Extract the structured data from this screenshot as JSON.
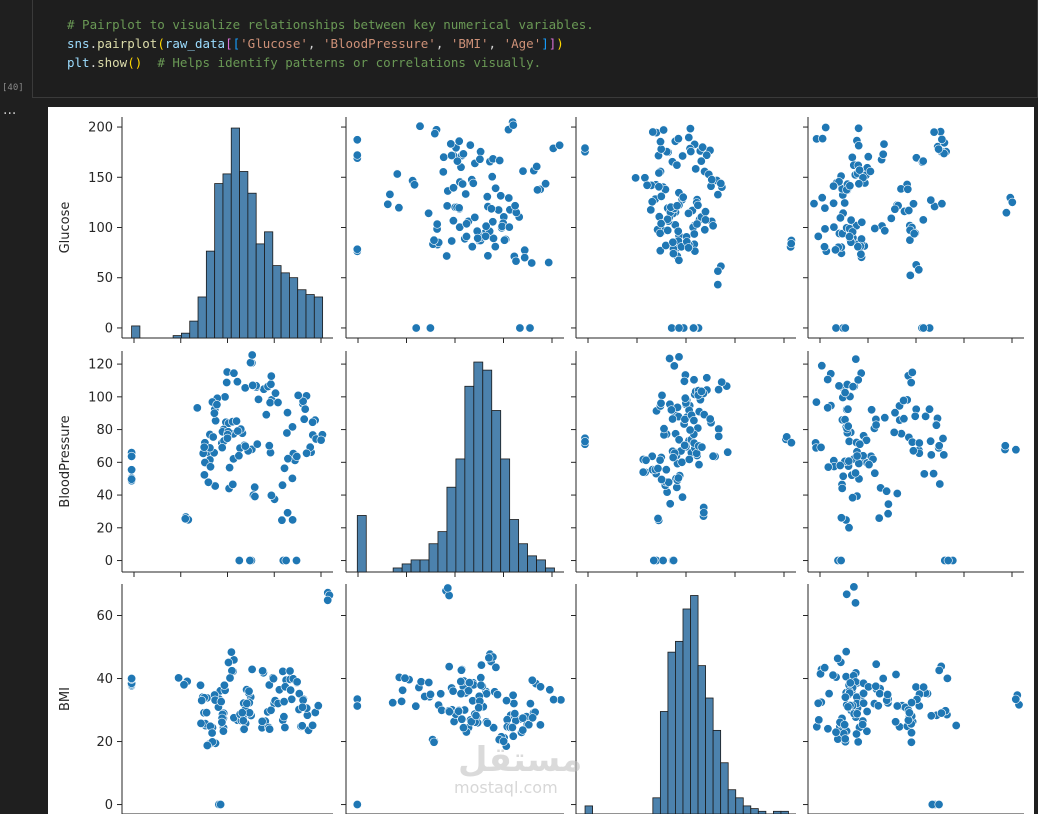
{
  "cell": {
    "execution_count": "[40]",
    "output_menu": "...",
    "code_lines": [
      {
        "tokens": [
          {
            "t": "# Pairplot to visualize relationships between key numerical variables.",
            "c": "comment"
          }
        ]
      },
      {
        "tokens": [
          {
            "t": "sns",
            "c": "var"
          },
          {
            "t": ".",
            "c": "punc"
          },
          {
            "t": "pairplot",
            "c": "func"
          },
          {
            "t": "(",
            "c": "brk1"
          },
          {
            "t": "raw_data",
            "c": "var"
          },
          {
            "t": "[",
            "c": "brk2"
          },
          {
            "t": "[",
            "c": "brk3"
          },
          {
            "t": "'Glucose'",
            "c": "str"
          },
          {
            "t": ", ",
            "c": "punc"
          },
          {
            "t": "'BloodPressure'",
            "c": "str"
          },
          {
            "t": ", ",
            "c": "punc"
          },
          {
            "t": "'BMI'",
            "c": "str"
          },
          {
            "t": ", ",
            "c": "punc"
          },
          {
            "t": "'Age'",
            "c": "str"
          },
          {
            "t": "]",
            "c": "brk3"
          },
          {
            "t": "]",
            "c": "brk2"
          },
          {
            "t": ")",
            "c": "brk1"
          }
        ]
      },
      {
        "tokens": [
          {
            "t": "plt",
            "c": "var"
          },
          {
            "t": ".",
            "c": "punc"
          },
          {
            "t": "show",
            "c": "func"
          },
          {
            "t": "()",
            "c": "brk1"
          },
          {
            "t": "  # Helps identify patterns or correlations visually.",
            "c": "comment"
          }
        ]
      }
    ]
  },
  "colors": {
    "point": "#1f77b4",
    "hist_fill": "#4c82ad",
    "hist_edge": "#1a1a1a",
    "axis": "#262626"
  },
  "watermark": {
    "text1": "مستقل",
    "text2": "mostaql.com"
  },
  "chart_data": {
    "type": "scatter",
    "kind": "pairplot",
    "variables": [
      "Glucose",
      "BloodPressure",
      "BMI",
      "Age"
    ],
    "visible_row_labels": [
      "Glucose",
      "BloodPressure",
      "BMI"
    ],
    "axes": {
      "Glucose": {
        "ylim": [
          -10,
          210
        ],
        "ticks": [
          0,
          50,
          100,
          150,
          200
        ]
      },
      "BloodPressure": {
        "ylim": [
          -7,
          128
        ],
        "ticks": [
          0,
          20,
          40,
          60,
          80,
          100,
          120
        ]
      },
      "BMI": {
        "ylim": [
          -3,
          70
        ],
        "ticks": [
          0,
          20,
          40,
          60
        ]
      }
    },
    "xlim": {
      "Glucose": [
        -10,
        210
      ],
      "BloodPressure": [
        -7,
        128
      ],
      "BMI": [
        -3,
        70
      ],
      "Age": [
        17,
        85
      ]
    },
    "histograms": {
      "Glucose": {
        "counts": [
          5,
          0,
          0,
          0,
          0,
          1,
          2,
          7,
          17,
          36,
          64,
          68,
          87,
          69,
          60,
          39,
          44,
          30,
          27,
          25,
          20,
          18,
          17
        ],
        "bin_start": 0,
        "bin_width": 8.66
      },
      "BloodPressure": {
        "counts": [
          14,
          0,
          0,
          0,
          1,
          2,
          3,
          3,
          7,
          10,
          21,
          28,
          46,
          52,
          50,
          40,
          28,
          13,
          7,
          4,
          3,
          1
        ],
        "bin_start": 0,
        "bin_width": 5.55
      },
      "BMI": {
        "counts": [
          3,
          0,
          0,
          0,
          0,
          0,
          0,
          0,
          0,
          6,
          38,
          60,
          64,
          76,
          81,
          55,
          43,
          31,
          19,
          9,
          6,
          3,
          2,
          1,
          0,
          1,
          1
        ],
        "bin_start": 0,
        "bin_width": 2.5
      }
    },
    "scatter": {
      "Glucose": [
        [
          0,
          0.06
        ],
        [
          99,
          0.3
        ],
        [
          79,
          0.24
        ],
        [
          92,
          0.08
        ],
        [
          137,
          0.38
        ],
        [
          115,
          0.6
        ],
        [
          126,
          0.18
        ],
        [
          125,
          0.28
        ],
        [
          97,
          0.44
        ],
        [
          170,
          0.51
        ],
        [
          145,
          0.15
        ],
        [
          87,
          0.71
        ],
        [
          181,
          0.36
        ],
        [
          89,
          0.4
        ],
        [
          138,
          0.2
        ],
        [
          75,
          0.69
        ],
        [
          160,
          0.25
        ],
        [
          148,
          0.55
        ],
        [
          104,
          0.6
        ],
        [
          194,
          0.45
        ],
        [
          166,
          0.28
        ],
        [
          118,
          0.5
        ],
        [
          107,
          0.17
        ],
        [
          78,
          0.2
        ],
        [
          183,
          0.37
        ],
        [
          112,
          0.64
        ],
        [
          86,
          0.52
        ],
        [
          169,
          0.43
        ],
        [
          142,
          0.27
        ],
        [
          84,
          0.13
        ],
        [
          123,
          0.82
        ],
        [
          152,
          0.35
        ],
        [
          0,
          0.36
        ],
        [
          197,
          0.28
        ],
        [
          120,
          0.19
        ],
        [
          95,
          0.46
        ],
        [
          57,
          0.36
        ],
        [
          163,
          0.3
        ],
        [
          102,
          0.47
        ],
        [
          179,
          0.55
        ]
      ],
      "BloodPressure": [
        [
          72,
          0.5
        ],
        [
          66,
          0.35
        ],
        [
          64,
          0.2
        ],
        [
          40,
          0.5
        ],
        [
          74,
          0.6
        ],
        [
          50,
          0.6
        ],
        [
          0,
          0.18
        ],
        [
          70,
          0.28
        ],
        [
          96,
          0.4
        ],
        [
          92,
          0.3
        ],
        [
          80,
          0.2
        ],
        [
          60,
          0.44
        ],
        [
          84,
          0.71
        ],
        [
          30,
          0.5
        ],
        [
          88,
          0.25
        ],
        [
          110,
          0.55
        ],
        [
          122,
          0.38
        ],
        [
          68,
          0.6
        ],
        [
          78,
          0.3
        ],
        [
          82,
          0.45
        ],
        [
          76,
          0.51
        ],
        [
          62,
          0.28
        ],
        [
          58,
          0.17
        ],
        [
          54,
          0.2
        ],
        [
          94,
          0.37
        ],
        [
          86,
          0.64
        ],
        [
          44,
          0.52
        ],
        [
          106,
          0.43
        ],
        [
          98,
          0.27
        ],
        [
          48,
          0.13
        ],
        [
          108,
          0.82
        ],
        [
          64,
          0.35
        ],
        [
          90,
          0.36
        ],
        [
          24,
          0.28
        ],
        [
          74,
          0.19
        ],
        [
          70,
          0.46
        ],
        [
          56,
          0.36
        ],
        [
          100,
          0.3
        ],
        [
          0,
          0.47
        ],
        [
          114,
          0.55
        ]
      ],
      "BMI": [
        [
          33.6,
          0.5
        ],
        [
          26.6,
          0.35
        ],
        [
          23.3,
          0.2
        ],
        [
          28.1,
          0.5
        ],
        [
          43.1,
          0.6
        ],
        [
          25.6,
          0.6
        ],
        [
          31.0,
          0.18
        ],
        [
          35.3,
          0.28
        ],
        [
          30.5,
          0.4
        ],
        [
          0,
          0.3
        ],
        [
          37.6,
          0.2
        ],
        [
          38.0,
          0.44
        ],
        [
          27.1,
          0.71
        ],
        [
          30.1,
          0.5
        ],
        [
          25.8,
          0.25
        ],
        [
          30.0,
          0.55
        ],
        [
          45.8,
          0.38
        ],
        [
          29.6,
          0.6
        ],
        [
          43.3,
          0.3
        ],
        [
          34.6,
          0.45
        ],
        [
          39.3,
          0.51
        ],
        [
          35.4,
          0.28
        ],
        [
          39.8,
          0.17
        ],
        [
          29.0,
          0.2
        ],
        [
          36.6,
          0.37
        ],
        [
          31.1,
          0.64
        ],
        [
          39.4,
          0.52
        ],
        [
          23.2,
          0.43
        ],
        [
          22.2,
          0.27
        ],
        [
          34.1,
          0.13
        ],
        [
          36.0,
          0.82
        ],
        [
          31.6,
          0.35
        ],
        [
          24.8,
          0.36
        ],
        [
          19.9,
          0.28
        ],
        [
          27.6,
          0.19
        ],
        [
          24.0,
          0.46
        ],
        [
          33.2,
          0.36
        ],
        [
          32.9,
          0.3
        ],
        [
          38.2,
          0.47
        ],
        [
          67.1,
          0.55
        ]
      ],
      "Age": [
        [
          50,
          0.5
        ],
        [
          31,
          0.35
        ],
        [
          32,
          0.2
        ],
        [
          21,
          0.5
        ],
        [
          33,
          0.6
        ],
        [
          30,
          0.6
        ],
        [
          26,
          0.18
        ],
        [
          29,
          0.28
        ],
        [
          53,
          0.4
        ],
        [
          54,
          0.3
        ],
        [
          30,
          0.2
        ],
        [
          34,
          0.44
        ],
        [
          57,
          0.71
        ],
        [
          59,
          0.5
        ],
        [
          51,
          0.25
        ],
        [
          32,
          0.55
        ],
        [
          31,
          0.38
        ],
        [
          31,
          0.6
        ],
        [
          33,
          0.3
        ],
        [
          32,
          0.45
        ],
        [
          27,
          0.51
        ],
        [
          50,
          0.28
        ],
        [
          41,
          0.17
        ],
        [
          29,
          0.2
        ],
        [
          51,
          0.37
        ],
        [
          41,
          0.64
        ],
        [
          43,
          0.52
        ],
        [
          22,
          0.43
        ],
        [
          57,
          0.27
        ],
        [
          38,
          0.13
        ],
        [
          60,
          0.82
        ],
        [
          28,
          0.35
        ],
        [
          22,
          0.36
        ],
        [
          28,
          0.28
        ],
        [
          45,
          0.19
        ],
        [
          33,
          0.46
        ],
        [
          35,
          0.36
        ],
        [
          46,
          0.3
        ],
        [
          27,
          0.47
        ],
        [
          81,
          0.55
        ]
      ]
    }
  }
}
